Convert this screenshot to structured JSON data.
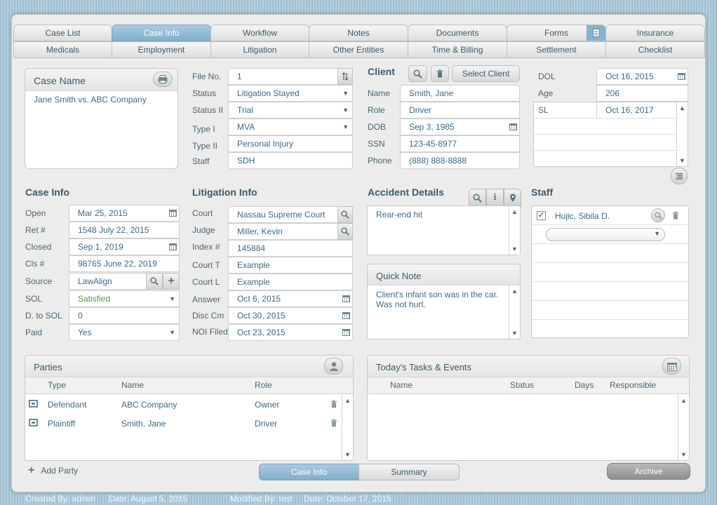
{
  "tabs_row1": [
    "Case List",
    "Case Info",
    "Workflow",
    "Notes",
    "Documents",
    "Forms",
    "Insurance"
  ],
  "tabs_row2": [
    "Medicals",
    "Employment",
    "Litigation",
    "Other Entities",
    "Time & Billing",
    "Settlement",
    "Checklist"
  ],
  "case_name": {
    "title": "Case Name",
    "value": "Jane Smith vs. ABC Company"
  },
  "file": {
    "labels": [
      "File No.",
      "Status",
      "Status II",
      "Type I",
      "Type II",
      "Staff"
    ],
    "values": [
      "1",
      "Litigation Stayed",
      "Trial",
      "MVA",
      "Personal Injury",
      "SDH"
    ]
  },
  "client": {
    "title": "Client",
    "select_label": "Select Client",
    "labels": [
      "Name",
      "Role",
      "DOB",
      "SSN",
      "Phone"
    ],
    "values": [
      "Smith, Jane",
      "Driver",
      "Sep 3, 1985",
      "123-45-8977",
      "(888) 888-8888"
    ]
  },
  "dol": {
    "labels": [
      "DOL",
      "Age",
      "SL"
    ],
    "values": [
      "Oct 16, 2015",
      "206",
      "Oct 16, 2017"
    ]
  },
  "case_info": {
    "title": "Case Info",
    "labels": [
      "Open",
      "Ret #",
      "Closed",
      "Cls #",
      "Source",
      "SOL",
      "D. to SOL",
      "Paid"
    ],
    "values": [
      "Mar 25, 2015",
      "1548 July 22, 2015",
      "Sep 1, 2019",
      "98765 June 22, 2019",
      "LawAlign",
      "Satisfied",
      "0",
      "Yes"
    ]
  },
  "litigation": {
    "title": "Litigation Info",
    "labels": [
      "Court",
      "Judge",
      "Index #",
      "Court T",
      "Court L",
      "Answer",
      "Disc Cm",
      "NOI Filed"
    ],
    "values": [
      "Nassau Supreme Court",
      "Miller, Kevin",
      "145884",
      "Example",
      "Example",
      "Oct 6, 2015",
      "Oct 30, 2015",
      "Oct 23, 2015"
    ]
  },
  "accident": {
    "title": "Accident Details",
    "text": "Rear-end hit"
  },
  "quick_note": {
    "title": "Quick Note",
    "text": "Client's infant son was in the car. Was not hurt."
  },
  "staff": {
    "title": "Staff",
    "member": "Hujic, Sibila D."
  },
  "parties": {
    "title": "Parties",
    "columns": [
      "Type",
      "Name",
      "Role"
    ],
    "rows": [
      {
        "type": "Defendant",
        "name": "ABC Company",
        "role": "Owner"
      },
      {
        "type": "Plaintiff",
        "name": "Smith, Jane",
        "role": "Driver"
      }
    ],
    "add_label": "Add Party"
  },
  "tasks": {
    "title": "Today's Tasks & Events",
    "columns": [
      "Name",
      "Status",
      "Days",
      "Responsible"
    ]
  },
  "bottom": {
    "case_info": "Case Info",
    "summary": "Summary",
    "archive": "Archive"
  },
  "footer": {
    "created_by": "Created By: admin",
    "created_date": "Date: August 5, 2015",
    "modified_by": "Modified By: test",
    "modified_date": "Date: October 17, 2015"
  },
  "colors": {
    "accent": "#86b3cf",
    "text": "#3d6a84",
    "sol_status": "#4a9a3a"
  },
  "icons": [
    "print-icon",
    "sort-icon",
    "search-icon",
    "trash-icon",
    "calendar-icon",
    "add-icon",
    "info-icon",
    "map-pin-icon",
    "person-icon",
    "list-icon",
    "checkbox-icon",
    "forms-icon",
    "party-card-icon"
  ]
}
